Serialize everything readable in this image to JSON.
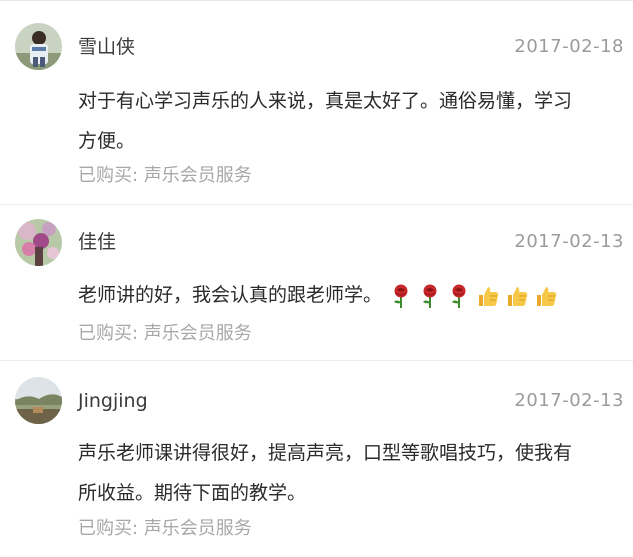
{
  "reviews": [
    {
      "username": "雪山侠",
      "date": "2017-02-18",
      "content_lines": [
        "对于有心学习声乐的人来说，真是太好了。通俗易懂，学习",
        "方便。"
      ],
      "purchase": "已购买: 声乐会员服务",
      "avatar_icon": "person-photo-avatar"
    },
    {
      "username": "佳佳",
      "date": "2017-02-13",
      "content_lines": [
        "老师讲的好，我会认真的跟老师学。"
      ],
      "emojis": [
        "rose-icon",
        "rose-icon",
        "rose-icon",
        "thumbs-up-icon",
        "thumbs-up-icon",
        "thumbs-up-icon"
      ],
      "purchase": "已购买: 声乐会员服务",
      "avatar_icon": "flower-photo-avatar"
    },
    {
      "username": "Jingjing",
      "date": "2017-02-13",
      "content_lines": [
        "声乐老师课讲得很好，提高声亮，口型等歌唱技巧，使我有",
        "所收益。期待下面的教学。"
      ],
      "purchase": "已购买: 声乐会员服务",
      "avatar_icon": "landscape-photo-avatar"
    }
  ],
  "colors": {
    "username": "#3b3b3b",
    "date": "#9b9b9b",
    "content": "#2b2b2b",
    "purchase": "#a8a8a8",
    "divider": "#ececec"
  }
}
